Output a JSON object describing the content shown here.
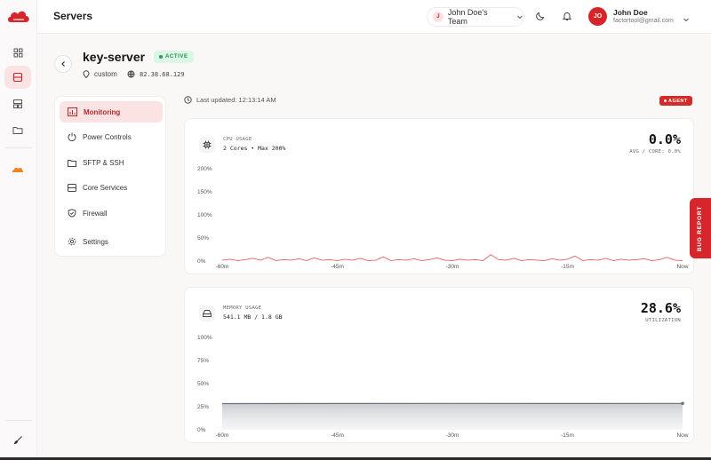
{
  "topbar": {
    "title": "Servers",
    "team": {
      "initial": "J",
      "label": "John Doe's Team"
    },
    "user": {
      "initials": "JO",
      "name": "John Doe",
      "email": "factortool@gmail.com"
    }
  },
  "rail": {
    "items": [
      "grid-icon",
      "servers-icon",
      "layout-icon",
      "folder-icon",
      "cloudflare-icon"
    ],
    "bottom": "brush-icon"
  },
  "server": {
    "name": "key-server",
    "status": "ACTIVE",
    "type": "custom",
    "ip": "82.38.68.129"
  },
  "menu": [
    {
      "label": "Monitoring",
      "icon": "chart-icon",
      "active": true
    },
    {
      "label": "Power Controls",
      "icon": "power-icon",
      "active": false
    },
    {
      "label": "SFTP & SSH",
      "icon": "folder-icon",
      "active": false
    },
    {
      "label": "Core Services",
      "icon": "server-icon",
      "active": false
    },
    {
      "label": "Firewall",
      "icon": "shield-icon",
      "active": false
    },
    {
      "label": "Settings",
      "icon": "gear-icon",
      "active": false
    }
  ],
  "main": {
    "updated": "Last updated: 12:13:14 AM",
    "agent": "AGENT",
    "cpu": {
      "label": "CPU USAGE",
      "sub": "2 Cores • Max 200%",
      "value": "0.0%",
      "caption": "AVG / CORE: 0.0%"
    },
    "memory": {
      "label": "MEMORY USAGE",
      "sub": "541.1 MB / 1.8 GB",
      "value": "28.6%",
      "caption": "UTILIZATION"
    }
  },
  "bug_report": "BUG REPORT",
  "colors": {
    "accent": "#d6262c",
    "active_bg": "#fbe3e3",
    "status_green": "#1f8f4f"
  },
  "chart_data": [
    {
      "type": "line",
      "title": "CPU USAGE",
      "x_ticks": [
        "-60m",
        "-45m",
        "-30m",
        "-15m",
        "Now"
      ],
      "y_ticks": [
        "200%",
        "150%",
        "100%",
        "50%",
        "0%"
      ],
      "ylim": [
        0,
        200
      ],
      "xlim": [
        -60,
        0
      ],
      "series": [
        {
          "x": [
            -60,
            -59,
            -58,
            -57,
            -56,
            -55,
            -54,
            -53,
            -52,
            -51,
            -50,
            -49,
            -48,
            -47,
            -46,
            -45,
            -44,
            -43,
            -42,
            -41,
            -40,
            -39,
            -38,
            -37,
            -36,
            -35,
            -34,
            -33,
            -32,
            -31,
            -30,
            -29,
            -28,
            -27,
            -26,
            -25,
            -24,
            -23,
            -22,
            -21,
            -20,
            -19,
            -18,
            -17,
            -16,
            -15,
            -14,
            -13,
            -12,
            -11,
            -10,
            -9,
            -8,
            -7,
            -6,
            -5,
            -4,
            -3,
            -2,
            -1,
            0
          ],
          "y": [
            2,
            4,
            1,
            3,
            6,
            2,
            8,
            1,
            3,
            2,
            5,
            1,
            7,
            2,
            3,
            1,
            4,
            2,
            6,
            1,
            2,
            9,
            1,
            3,
            2,
            5,
            1,
            3,
            7,
            2,
            1,
            4,
            2,
            3,
            1,
            14,
            3,
            2,
            6,
            1,
            3,
            2,
            1,
            5,
            2,
            4,
            11,
            1,
            3,
            2,
            6,
            1,
            4,
            2,
            3,
            5,
            1,
            3,
            8,
            2,
            1
          ]
        }
      ]
    },
    {
      "type": "area",
      "title": "MEMORY USAGE",
      "x_ticks": [
        "-60m",
        "-45m",
        "-30m",
        "-15m",
        "Now"
      ],
      "y_ticks": [
        "100%",
        "75%",
        "50%",
        "25%",
        "0%"
      ],
      "ylim": [
        0,
        100
      ],
      "xlim": [
        -60,
        0
      ],
      "series": [
        {
          "x": [
            -60,
            -45,
            -30,
            -15,
            0
          ],
          "y": [
            28.4,
            28.5,
            28.6,
            28.5,
            28.6
          ]
        }
      ]
    }
  ]
}
